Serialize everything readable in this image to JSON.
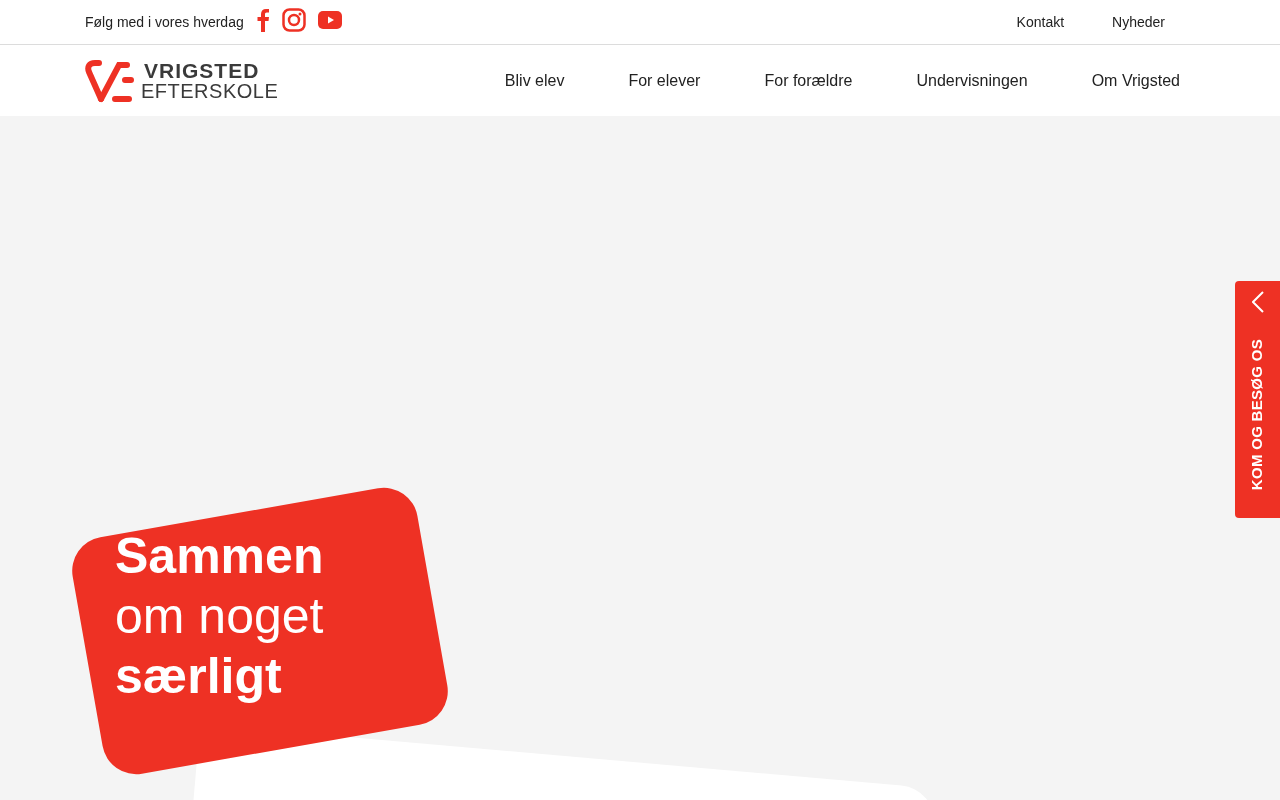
{
  "topbar": {
    "follow_text": "Følg med i vores hverdag",
    "social": [
      {
        "kind": "facebook"
      },
      {
        "kind": "instagram"
      },
      {
        "kind": "youtube"
      }
    ],
    "links": [
      "Kontakt",
      "Nyheder"
    ]
  },
  "logo": {
    "line_1": "VRIGSTED",
    "line_2": "EFTERSKOLE"
  },
  "nav": [
    "Bliv elev",
    "For elever",
    "For forældre",
    "Undervisningen",
    "Om Vrigsted"
  ],
  "hero": {
    "headline": [
      {
        "text": "Sammen",
        "bold": true
      },
      {
        "text": "om noget",
        "bold": false
      },
      {
        "text": "særligt",
        "bold": true
      }
    ]
  },
  "side_tab": {
    "label": "KOM OG BESØG OS"
  }
}
